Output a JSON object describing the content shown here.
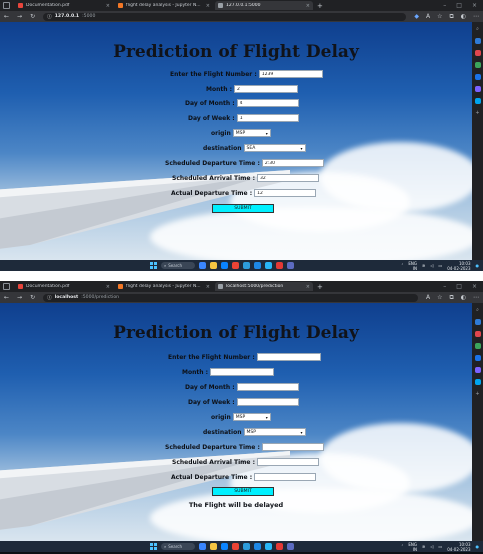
{
  "browser": {
    "tabs": [
      {
        "title": "Documentation.pdf",
        "favicon_color": "#e8453c"
      },
      {
        "title": "flight delay analysis - Jupyter N...",
        "favicon_color": "#f37726"
      },
      {
        "title": "127.0.0.1:5000",
        "favicon_color": "#9aa0a6"
      }
    ],
    "tabs_bottom": [
      {
        "title": "Documentation.pdf",
        "favicon_color": "#e8453c"
      },
      {
        "title": "flight delay analysis - Jupyter N...",
        "favicon_color": "#f37726"
      },
      {
        "title": "localhost:5000/prediction",
        "favicon_color": "#9aa0a6"
      }
    ],
    "url_top": {
      "host": "127.0.0.1",
      "path": ":5000"
    },
    "url_bottom": {
      "host": "localhost",
      "path": ":5000/prediction"
    }
  },
  "page": {
    "title": "Prediction of Flight Delay",
    "labels": {
      "flight_number": "Enter the Flight Number :",
      "month": "Month :",
      "day_of_month": "Day of Month :",
      "day_of_week": "Day of Week :",
      "origin": "origin",
      "destination": "destination",
      "sched_dep": "Scheduled Departure Time :",
      "sched_arr": "Scheduled Arrival Time :",
      "actual_dep": "Actual Departure Time :"
    },
    "submit_label": "SUBMIT"
  },
  "form_top": {
    "flight_number": "1239",
    "month": "2",
    "day_of_month": "4",
    "day_of_week": "1",
    "origin": "MSP",
    "destination": "SEA",
    "sched_dep": "2:30",
    "sched_arr": "32",
    "actual_dep": "12"
  },
  "form_bottom": {
    "flight_number": "",
    "month": "",
    "day_of_month": "",
    "day_of_week": "",
    "origin": "MSP",
    "destination": "MSP",
    "sched_dep": "",
    "sched_arr": "",
    "actual_dep": "",
    "result": "The Flight will be delayed"
  },
  "taskbar": {
    "search_label": "Search",
    "lang": "ENG",
    "region": "IN",
    "time": "10:03",
    "date": "04-02-2023"
  },
  "icons": {
    "start": "windows-start-icon",
    "search": "search-icon",
    "back": "back-arrow-icon",
    "forward": "forward-arrow-icon",
    "refresh": "refresh-icon",
    "info": "info-icon"
  }
}
